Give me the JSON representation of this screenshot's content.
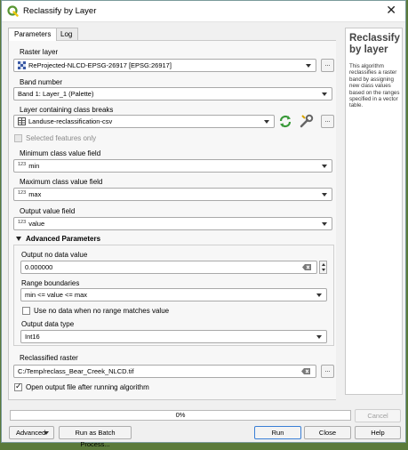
{
  "window": {
    "title": "Reclassify by Layer"
  },
  "tabs": [
    {
      "label": "Parameters"
    },
    {
      "label": "Log"
    }
  ],
  "params": {
    "raster_layer": {
      "label": "Raster layer",
      "value": "ReProjected-NLCD-EPSG-26917 [EPSG:26917]"
    },
    "band_number": {
      "label": "Band number",
      "value": "Band 1: Layer_1 (Palette)"
    },
    "class_breaks": {
      "label": "Layer containing class breaks",
      "value": "Landuse-reclassification-csv"
    },
    "selected_only": {
      "label": "Selected features only",
      "checked": false
    },
    "min_field": {
      "label": "Minimum class value field",
      "value": "min",
      "type_badge": "123"
    },
    "max_field": {
      "label": "Maximum class value field",
      "value": "max",
      "type_badge": "123"
    },
    "output_field": {
      "label": "Output value field",
      "value": "value",
      "type_badge": "123"
    }
  },
  "advanced": {
    "header": "Advanced Parameters",
    "nodata": {
      "label": "Output no data value",
      "value": "0.000000"
    },
    "range": {
      "label": "Range boundaries",
      "value": "min <= value <= max"
    },
    "nodata_nomatch": {
      "label": "Use no data when no range matches value",
      "checked": false
    },
    "data_type": {
      "label": "Output data type",
      "value": "Int16"
    }
  },
  "output": {
    "label": "Reclassified raster",
    "value": "C:/Temp/reclass_Bear_Creek_NLCD.tif",
    "open_after": {
      "label": "Open output file after running algorithm",
      "checked": true
    }
  },
  "help": {
    "title": "Reclassify by layer",
    "body": "This algorithm reclassifies a raster band by assigning new class values based on the ranges specified in a vector table."
  },
  "progress": {
    "value": 0,
    "text": "0%"
  },
  "buttons": {
    "cancel": "Cancel",
    "advanced": "Advanced",
    "batch": "Run as Batch Process...",
    "run": "Run",
    "close": "Close",
    "help": "Help",
    "ellipsis": "..."
  },
  "colors": {
    "qgis_green": "#589632",
    "qgis_yellow": "#eec90d",
    "accent": "#3a7fd6"
  }
}
